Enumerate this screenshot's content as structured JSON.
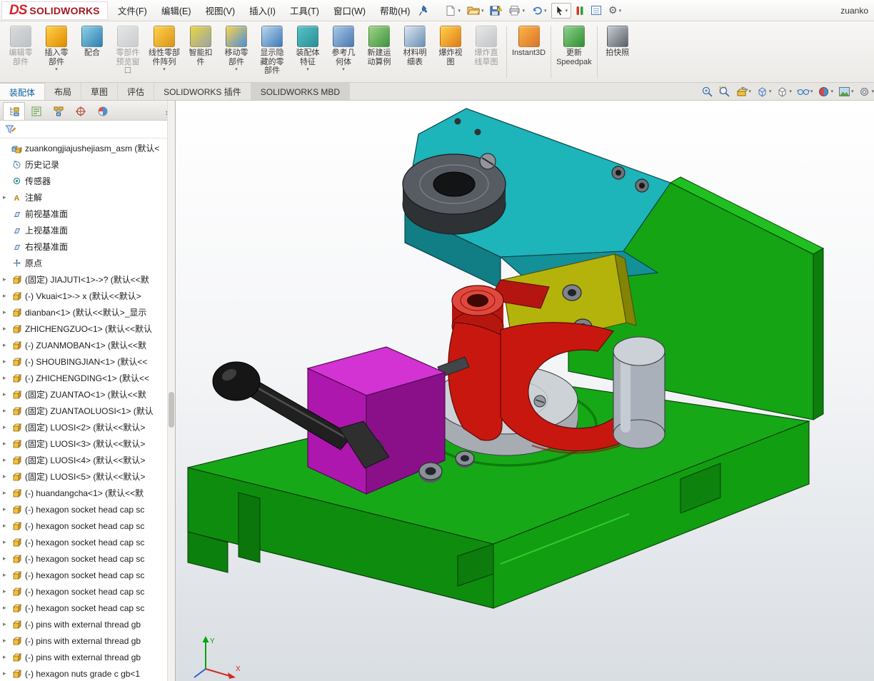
{
  "window": {
    "title": "zuanko"
  },
  "menubar": {
    "logo": {
      "ds": "DS",
      "brand": "SOLIDWORKS"
    },
    "items": [
      "文件(F)",
      "编辑(E)",
      "视图(V)",
      "插入(I)",
      "工具(T)",
      "窗口(W)",
      "帮助(H)"
    ]
  },
  "quickbar": {
    "icons": [
      {
        "name": "new-document-icon",
        "dropdown": true
      },
      {
        "name": "open-icon",
        "dropdown": true
      },
      {
        "name": "save-icon",
        "dropdown": false
      },
      {
        "name": "print-icon",
        "dropdown": true
      },
      {
        "name": "undo-icon",
        "dropdown": true
      },
      {
        "name": "select-cursor-icon",
        "dropdown": true,
        "boxed": true
      },
      {
        "name": "rebuild-bars-icon",
        "dropdown": false
      },
      {
        "name": "task-list-icon",
        "dropdown": false
      },
      {
        "name": "options-gear-icon",
        "dropdown": true
      }
    ]
  },
  "ribbon": {
    "buttons": [
      {
        "name": "edit-component-button",
        "icon": "edit-component-icon",
        "label_lines": [
          "编辑零",
          "部件"
        ],
        "disabled": true,
        "dropdown": false,
        "c1": "#aebfcf",
        "c2": "#6e89a6"
      },
      {
        "name": "insert-component-button",
        "icon": "insert-component-icon",
        "label_lines": [
          "插入零",
          "部件"
        ],
        "disabled": false,
        "dropdown": true,
        "c1": "#ffd24a",
        "c2": "#e08a00"
      },
      {
        "name": "mate-button",
        "icon": "mate-icon",
        "label_lines": [
          "配合"
        ],
        "disabled": false,
        "dropdown": false,
        "c1": "#8fd0e8",
        "c2": "#2e7fb0"
      },
      {
        "name": "component-preview-button",
        "icon": "component-preview-icon",
        "label_lines": [
          "零部件",
          "预览窗",
          "口"
        ],
        "disabled": true,
        "dropdown": false,
        "c1": "#c9d4de",
        "c2": "#8fa3b5"
      },
      {
        "name": "linear-pattern-button",
        "icon": "linear-pattern-icon",
        "label_lines": [
          "线性零部",
          "件阵列"
        ],
        "disabled": false,
        "dropdown": true,
        "c1": "#ffd24a",
        "c2": "#d9941a"
      },
      {
        "name": "smart-fasteners-button",
        "icon": "smart-fasteners-icon",
        "label_lines": [
          "智能扣",
          "件"
        ],
        "disabled": false,
        "dropdown": false,
        "c1": "#e8d83a",
        "c2": "#9aa2ab"
      },
      {
        "name": "move-component-button",
        "icon": "move-component-icon",
        "label_lines": [
          "移动零",
          "部件"
        ],
        "disabled": false,
        "dropdown": true,
        "c1": "#ffd24a",
        "c2": "#4a90d9"
      },
      {
        "name": "show-hidden-button",
        "icon": "show-hidden-icon",
        "label_lines": [
          "显示隐",
          "藏的零",
          "部件"
        ],
        "disabled": false,
        "dropdown": false,
        "c1": "#bcd6ee",
        "c2": "#3d7ab8"
      },
      {
        "name": "assembly-features-button",
        "icon": "assembly-features-icon",
        "label_lines": [
          "装配体",
          "特征"
        ],
        "disabled": false,
        "dropdown": true,
        "c1": "#57c2c8",
        "c2": "#2a8f96"
      },
      {
        "name": "reference-geometry-button",
        "icon": "reference-geometry-icon",
        "label_lines": [
          "参考几",
          "何体"
        ],
        "disabled": false,
        "dropdown": true,
        "c1": "#a8c8e8",
        "c2": "#4a78b0"
      },
      {
        "name": "new-motion-study-button",
        "icon": "new-motion-study-icon",
        "label_lines": [
          "新建运",
          "动算例"
        ],
        "disabled": false,
        "dropdown": false,
        "c1": "#9fd486",
        "c2": "#3f9340"
      },
      {
        "name": "bom-button",
        "icon": "bom-icon",
        "label_lines": [
          "材料明",
          "细表"
        ],
        "disabled": false,
        "dropdown": false,
        "c1": "#dce6f0",
        "c2": "#6a8fb5"
      },
      {
        "name": "exploded-view-button",
        "icon": "exploded-view-icon",
        "label_lines": [
          "爆炸视",
          "图"
        ],
        "disabled": false,
        "dropdown": false,
        "c1": "#ffd24a",
        "c2": "#e07a1a"
      },
      {
        "name": "explode-line-sketch-button",
        "icon": "explode-line-sketch-icon",
        "label_lines": [
          "爆炸直",
          "线草图"
        ],
        "disabled": true,
        "dropdown": false,
        "c1": "#d0d8e0",
        "c2": "#8090a0"
      },
      {
        "name": "instant3d-button",
        "icon": "instant3d-icon",
        "label_lines": [
          "Instant3D"
        ],
        "disabled": false,
        "dropdown": false,
        "sep_before": true,
        "c1": "#ffb347",
        "c2": "#d9742a"
      },
      {
        "name": "update-speedpak-button",
        "icon": "update-speedpak-icon",
        "label_lines": [
          "更新",
          "Speedpak"
        ],
        "disabled": false,
        "dropdown": false,
        "sep_before": true,
        "c1": "#8fd08f",
        "c2": "#2f8f2f"
      },
      {
        "name": "take-snapshot-button",
        "icon": "take-snapshot-icon",
        "label_lines": [
          "拍快照"
        ],
        "disabled": false,
        "dropdown": false,
        "sep_before": true,
        "c1": "#c8cdd2",
        "c2": "#5a6068"
      }
    ]
  },
  "tabs": {
    "items": [
      {
        "label": "装配体",
        "active": true
      },
      {
        "label": "布局"
      },
      {
        "label": "草图"
      },
      {
        "label": "评估"
      },
      {
        "label": "SOLIDWORKS 插件"
      },
      {
        "label": "SOLIDWORKS MBD",
        "shaded": true
      }
    ]
  },
  "viewbar": {
    "icons": [
      {
        "name": "zoom-fit-icon",
        "dropdown": false
      },
      {
        "name": "zoom-area-icon",
        "dropdown": false
      },
      {
        "name": "section-view-icon",
        "dropdown": true
      },
      {
        "name": "view-orientation-icon",
        "dropdown": true
      },
      {
        "name": "display-style-icon",
        "dropdown": true
      },
      {
        "name": "hide-show-items-icon",
        "dropdown": true
      },
      {
        "name": "edit-appearance-icon",
        "dropdown": true
      },
      {
        "name": "apply-scene-icon",
        "dropdown": true
      },
      {
        "name": "view-settings-icon",
        "dropdown": true
      }
    ]
  },
  "panel": {
    "tabs": [
      {
        "name": "featuremanager-tab",
        "icon": "featuremanager-tab-icon",
        "active": true
      },
      {
        "name": "propertymanager-tab",
        "icon": "propertymanager-tab-icon"
      },
      {
        "name": "configurationmanager-tab",
        "icon": "configurationmanager-tab-icon"
      },
      {
        "name": "dimxpertmanager-tab",
        "icon": "dimxpertmanager-tab-icon"
      },
      {
        "name": "displaymanager-tab",
        "icon": "displaymanager-tab-icon"
      }
    ],
    "more_glyph": "›",
    "tree": [
      {
        "icon": "assembly",
        "arrow": false,
        "root": true,
        "label": "zuankongjiajushejiasm_asm (默认<"
      },
      {
        "icon": "history",
        "arrow": false,
        "label": "历史记录"
      },
      {
        "icon": "sensors",
        "arrow": false,
        "label": "传感器"
      },
      {
        "icon": "annotations",
        "arrow": true,
        "label": "注解"
      },
      {
        "icon": "plane",
        "arrow": false,
        "label": "前视基准面"
      },
      {
        "icon": "plane",
        "arrow": false,
        "label": "上视基准面"
      },
      {
        "icon": "plane",
        "arrow": false,
        "label": "右视基准面"
      },
      {
        "icon": "origin",
        "arrow": false,
        "label": "原点"
      },
      {
        "icon": "part",
        "arrow": true,
        "label": "(固定) JIAJUTI<1>->? (默认<<默"
      },
      {
        "icon": "part",
        "arrow": true,
        "label": "(-) Vkuai<1>-> x (默认<<默认>"
      },
      {
        "icon": "part",
        "arrow": true,
        "label": "dianban<1> (默认<<默认>_显示"
      },
      {
        "icon": "part",
        "arrow": true,
        "label": "ZHICHENGZUO<1> (默认<<默认"
      },
      {
        "icon": "part",
        "arrow": true,
        "label": "(-) ZUANMOBAN<1> (默认<<默"
      },
      {
        "icon": "part",
        "arrow": true,
        "label": "(-) SHOUBINGJIAN<1> (默认<<"
      },
      {
        "icon": "part",
        "arrow": true,
        "label": "(-) ZHICHENGDING<1> (默认<<"
      },
      {
        "icon": "part",
        "arrow": true,
        "label": "(固定) ZUANTAO<1> (默认<<默"
      },
      {
        "icon": "part",
        "arrow": true,
        "label": "(固定) ZUANTAOLUOSI<1> (默认"
      },
      {
        "icon": "part",
        "arrow": true,
        "label": "(固定) LUOSI<2> (默认<<默认>"
      },
      {
        "icon": "part",
        "arrow": true,
        "label": "(固定) LUOSI<3> (默认<<默认>"
      },
      {
        "icon": "part",
        "arrow": true,
        "label": "(固定) LUOSI<4> (默认<<默认>"
      },
      {
        "icon": "part",
        "arrow": true,
        "label": "(固定) LUOSI<5> (默认<<默认>"
      },
      {
        "icon": "part",
        "arrow": true,
        "label": "(-) huandangcha<1> (默认<<默"
      },
      {
        "icon": "fastener",
        "arrow": true,
        "label": "(-) hexagon socket head cap sc"
      },
      {
        "icon": "fastener",
        "arrow": true,
        "label": "(-) hexagon socket head cap sc"
      },
      {
        "icon": "fastener",
        "arrow": true,
        "label": "(-) hexagon socket head cap sc"
      },
      {
        "icon": "fastener",
        "arrow": true,
        "label": "(-) hexagon socket head cap sc"
      },
      {
        "icon": "fastener",
        "arrow": true,
        "label": "(-) hexagon socket head cap sc"
      },
      {
        "icon": "fastener",
        "arrow": true,
        "label": "(-) hexagon socket head cap sc"
      },
      {
        "icon": "fastener",
        "arrow": true,
        "label": "(-) hexagon socket head cap sc"
      },
      {
        "icon": "fastener",
        "arrow": true,
        "label": "(-) pins with external thread gb"
      },
      {
        "icon": "fastener",
        "arrow": true,
        "label": "(-) pins with external thread gb"
      },
      {
        "icon": "fastener",
        "arrow": true,
        "label": "(-) pins with external thread gb"
      },
      {
        "icon": "fastener",
        "arrow": true,
        "label": "(-) hexagon nuts grade c gb<1"
      }
    ]
  },
  "viewport": {
    "triad": {
      "x": "X",
      "y": "Y"
    }
  },
  "model": {
    "palette": {
      "base_green": "#17a817",
      "base_green_dark": "#0e8c0e",
      "back_wall_green": "#14a414",
      "arm_teal": "#1db4ba",
      "arm_teal_dark": "#117d85",
      "block_yellow": "#b3b30c",
      "clamp_red": "#c8170f",
      "slide_magenta": "#c12ec1",
      "pin_gray": "#a9b0ba",
      "platen_gray": "#cdd2d6",
      "handle_black": "#1a1a1a",
      "bushing_gray": "#575c62"
    }
  }
}
